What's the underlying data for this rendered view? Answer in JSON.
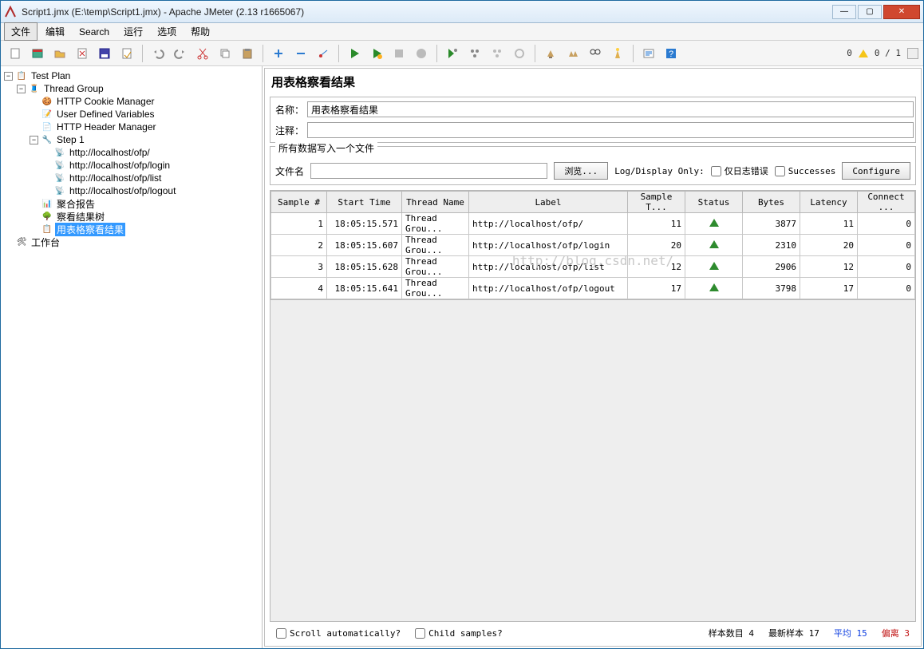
{
  "window": {
    "title": "Script1.jmx (E:\\temp\\Script1.jmx) - Apache JMeter (2.13 r1665067)"
  },
  "menu": {
    "file": "文件",
    "edit": "编辑",
    "search": "Search",
    "run": "运行",
    "options": "选项",
    "help": "帮助"
  },
  "toolbar_status": {
    "left_count": "0",
    "right_count": "0 / 1"
  },
  "tree": {
    "test_plan": "Test Plan",
    "thread_group": "Thread Group",
    "cookie_mgr": "HTTP Cookie Manager",
    "user_vars": "User Defined Variables",
    "header_mgr": "HTTP Header Manager",
    "step1": "Step 1",
    "req1": "http://localhost/ofp/",
    "req2": "http://localhost/ofp/login",
    "req3": "http://localhost/ofp/list",
    "req4": "http://localhost/ofp/logout",
    "agg": "聚合报告",
    "tree_result": "察看结果树",
    "table_result": "用表格察看结果",
    "workbench": "工作台"
  },
  "panel": {
    "title": "用表格察看结果",
    "name_label": "名称：",
    "name_value": "用表格察看结果",
    "comment_label": "注释：",
    "comment_value": "",
    "file_group": "所有数据写入一个文件",
    "filename_label": "文件名",
    "filename_value": "",
    "browse": "浏览...",
    "logdisplay": "Log/Display Only:",
    "errors_only": "仅日志错误",
    "successes": "Successes",
    "configure": "Configure"
  },
  "table": {
    "headers": {
      "sample": "Sample #",
      "start": "Start Time",
      "thread": "Thread Name",
      "label": "Label",
      "sampletime": "Sample T...",
      "status": "Status",
      "bytes": "Bytes",
      "latency": "Latency",
      "connect": "Connect ..."
    },
    "rows": [
      {
        "n": "1",
        "start": "18:05:15.571",
        "thread": "Thread Grou...",
        "label": "http://localhost/ofp/",
        "st": "11",
        "bytes": "3877",
        "lat": "11",
        "conn": "0"
      },
      {
        "n": "2",
        "start": "18:05:15.607",
        "thread": "Thread Grou...",
        "label": "http://localhost/ofp/login",
        "st": "20",
        "bytes": "2310",
        "lat": "20",
        "conn": "0"
      },
      {
        "n": "3",
        "start": "18:05:15.628",
        "thread": "Thread Grou...",
        "label": "http://localhost/ofp/list",
        "st": "12",
        "bytes": "2906",
        "lat": "12",
        "conn": "0"
      },
      {
        "n": "4",
        "start": "18:05:15.641",
        "thread": "Thread Grou...",
        "label": "http://localhost/ofp/logout",
        "st": "17",
        "bytes": "3798",
        "lat": "17",
        "conn": "0"
      }
    ]
  },
  "footer": {
    "scroll": "Scroll automatically?",
    "child": "Child samples?",
    "samples_label": "样本数目",
    "samples_value": "4",
    "latest_label": "最新样本",
    "latest_value": "17",
    "avg_label": "平均",
    "avg_value": "15",
    "dev_label": "偏离",
    "dev_value": "3"
  },
  "watermark": "http://blog.csdn.net/"
}
